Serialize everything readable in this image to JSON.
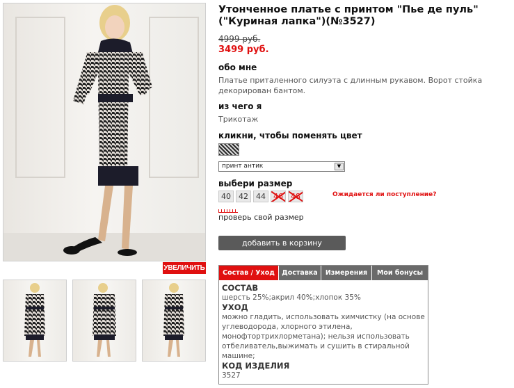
{
  "gallery": {
    "enlarge_label": "УВЕЛИЧИТЬ"
  },
  "product": {
    "title": "Утонченное платье с принтом \"Пье де пуль\"(\"Куриная лапка\")(№3527)",
    "old_price": "4999 руб.",
    "new_price": "3499 руб.",
    "about_heading": "обо мне",
    "about_text": "Платье приталенного силуэта с длинным рукавом. Ворот стойка декорирован бантом.",
    "material_heading": "из чего я",
    "material_text": "Трикотаж",
    "color_heading": "кликни, чтобы поменять цвет",
    "color_selected": "принт антик",
    "size_heading": "выбери размер",
    "sizes": [
      {
        "label": "40",
        "available": true
      },
      {
        "label": "42",
        "available": true
      },
      {
        "label": "44",
        "available": true
      },
      {
        "label": "46",
        "available": false
      },
      {
        "label": "48",
        "available": false
      }
    ],
    "await_link": "Ожидается ли поступление?",
    "check_size": "проверь свой размер",
    "add_to_cart": "добавить в корзину"
  },
  "tabs": {
    "items": [
      "Состав / Уход",
      "Доставка",
      "Измерения",
      "Мои бонусы"
    ],
    "active_index": 0,
    "content": {
      "composition_heading": "СОСТАВ",
      "composition": "шерсть 25%;акрил 40%;хлопок 35%",
      "care_heading": "УХОД",
      "care_lines": [
        "можно гладить, использовать химчистку (на основе",
        "углеводорода, хлорного этилена,",
        "монофтортрихлорметана); нельзя использовать",
        "отбеливатель,выжимать и сушить в стиральной",
        "машине;"
      ],
      "code_heading": "КОД ИЗДЕЛИЯ",
      "code": "3527"
    }
  },
  "colors": {
    "accent_red": "#e01010",
    "button_gray": "#5a5a5a",
    "tab_gray": "#6a6a6a"
  }
}
